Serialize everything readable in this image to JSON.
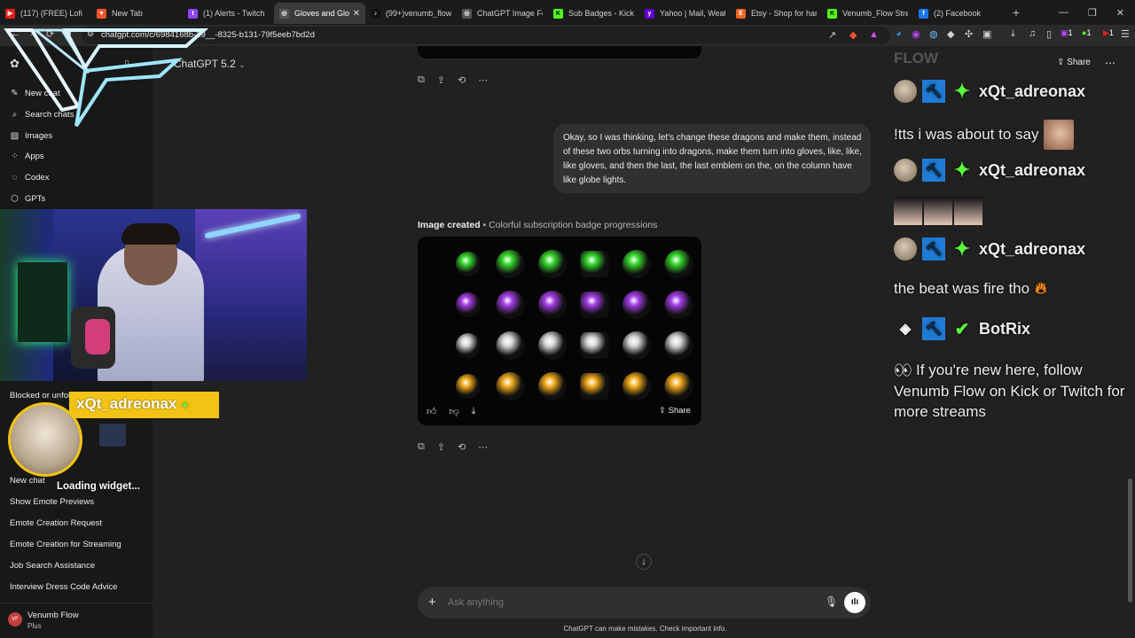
{
  "browser": {
    "tabs": [
      {
        "title": "(117) (FREE) Lofi",
        "favicon": "youtube-icon",
        "color": "#e62117"
      },
      {
        "title": "New Tab",
        "favicon": "brave-icon",
        "color": "#fb542b"
      },
      {
        "title": "(1) Alerts - Twitch",
        "favicon": "twitch-icon",
        "color": "#9146ff"
      },
      {
        "title": "Gloves and Glo",
        "favicon": "chatgpt-icon",
        "color": "#bbbbbb",
        "active": true
      },
      {
        "title": "(99+)venumb_flow",
        "favicon": "tiktok-icon",
        "color": "#111111"
      },
      {
        "title": "ChatGPT Image Feb",
        "favicon": "chatgpt-icon",
        "color": "#bbbbbb"
      },
      {
        "title": "Sub Badges - Kick D",
        "favicon": "kick-icon",
        "color": "#53fc18"
      },
      {
        "title": "Yahoo | Mail, Weath",
        "favicon": "yahoo-icon",
        "color": "#6001d2"
      },
      {
        "title": "Etsy - Shop for han",
        "favicon": "etsy-icon",
        "color": "#f1641e"
      },
      {
        "title": "Venumb_Flow Strea",
        "favicon": "kick-icon",
        "color": "#53fc18"
      },
      {
        "title": "(2) Facebook",
        "favicon": "facebook-icon",
        "color": "#1877f2"
      }
    ],
    "url": "chatgpt.com/c/6984168b-39__-8325-b131-79f5eeb7bd2d",
    "ext_counts": [
      "1",
      "1",
      "1"
    ]
  },
  "sidebar": {
    "model_label": "ChatGPT 5.2",
    "nav": [
      {
        "label": "New chat",
        "icon": "edit-icon"
      },
      {
        "label": "Search chats",
        "icon": "search-icon"
      },
      {
        "label": "Images",
        "icon": "image-icon"
      },
      {
        "label": "Apps",
        "icon": "apps-icon"
      },
      {
        "label": "Codex",
        "icon": "codex-icon"
      },
      {
        "label": "GPTs",
        "icon": "gpts-icon"
      }
    ],
    "chats": [
      "Blocked or unfol",
      "New chat",
      "Show Emote Previews",
      "Emote Creation Request",
      "Emote Creation for Streaming",
      "Job Search Assistance",
      "Interview Dress Code Advice"
    ],
    "user": {
      "name": "Venumb Flow",
      "plan": "Plus",
      "initials": "VF"
    },
    "overlay_name": "xQt_adreonax",
    "loading_text": "Loading widget..."
  },
  "main": {
    "user_message": "Okay, so I was thinking, let's change these dragons and make them, instead of these two orbs turning into dragons, make them turn into gloves, like, like, like gloves, and then the last, the last emblem on the, on the column have like globe lights.",
    "image_caption_bold": "Image created",
    "image_caption_sub": " • Colorful subscription badge progressions",
    "share_label": "Share",
    "composer_placeholder": "Ask anything",
    "disclaimer": "ChatGPT can make mistakes. Check important info.",
    "header_share": "Share",
    "badge_rows": [
      "#37d82c",
      "#a43de6",
      "#d6d6d6",
      "#f0a91b"
    ]
  },
  "overlay": {
    "flow_text": "FLOW",
    "lines": [
      {
        "type": "user",
        "name": "xQt_adreonax"
      },
      {
        "type": "text",
        "text": "!tts i was about to say"
      },
      {
        "type": "user",
        "name": "xQt_adreonax"
      },
      {
        "type": "emotes"
      },
      {
        "type": "user",
        "name": "xQt_adreonax"
      },
      {
        "type": "text",
        "text": "the beat was fire tho"
      },
      {
        "type": "bot",
        "name": "BotRix"
      }
    ],
    "bot_message": "If you're new here, follow Venumb Flow on Kick or Twitch for more streams"
  }
}
